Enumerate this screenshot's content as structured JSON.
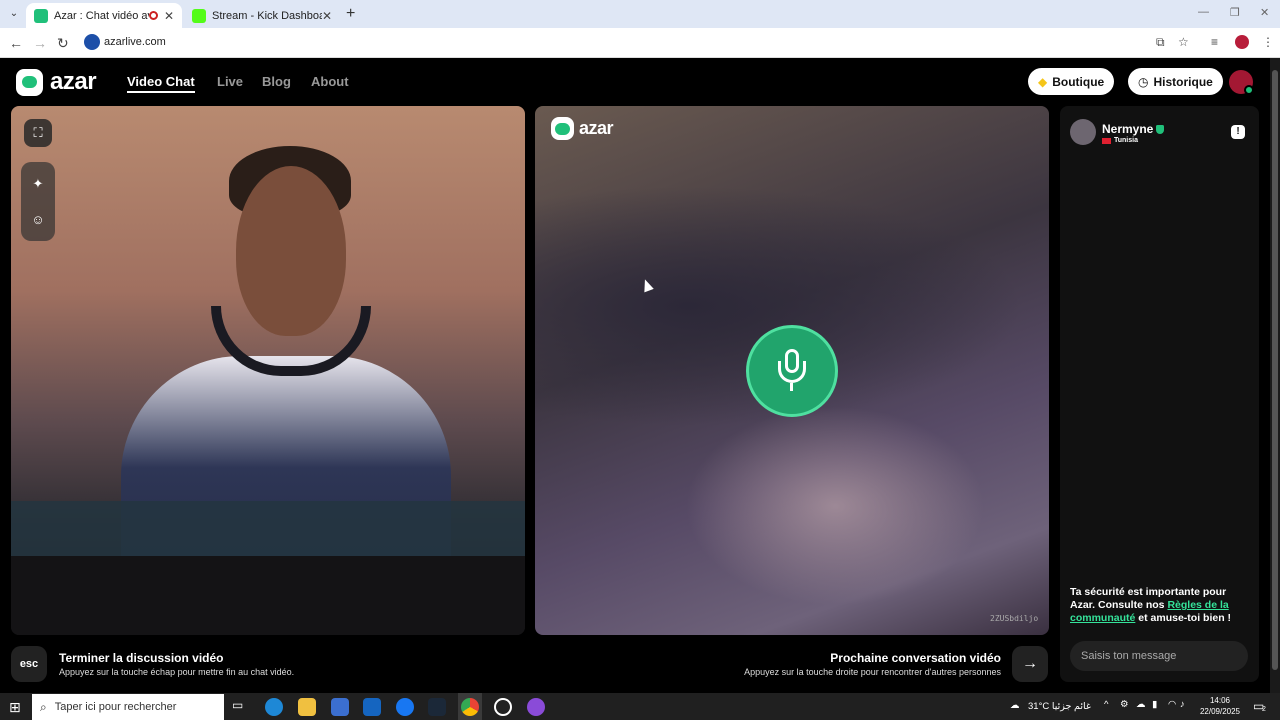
{
  "browser": {
    "tabs": [
      {
        "title": "Azar : Chat vidéo avec de n",
        "active": true
      },
      {
        "title": "Stream - Kick Dashboard",
        "active": false
      }
    ],
    "url": "azarlive.com"
  },
  "header": {
    "logo": "azar",
    "nav": [
      "Video Chat",
      "Live",
      "Blog",
      "About"
    ],
    "boutique": "Boutique",
    "historique": "Historique"
  },
  "remote": {
    "logo": "azar",
    "video_id": "2ZUSbdiljo"
  },
  "chat": {
    "name": "Nermyne",
    "country": "Tunisia",
    "safety_prefix": "Ta sécurité est importante pour Azar. Consulte nos ",
    "safety_link": "Règles de la communauté",
    "safety_suffix": " et amuse-toi bien !",
    "input_placeholder": "Saisis ton message"
  },
  "actions": {
    "esc_label": "esc",
    "end_title": "Terminer la discussion vidéo",
    "end_sub": "Appuyez sur la touche échap pour mettre fin au chat vidéo.",
    "next_title": "Prochaine conversation vidéo",
    "next_sub": "Appuyez sur la touche droite pour rencontrer d'autres personnes",
    "next_arrow": "→"
  },
  "taskbar": {
    "search_placeholder": "Taper ici pour rechercher",
    "weather": "31°C  غائم جزئيا",
    "time": "14:06",
    "date": "22/09/2025",
    "notifications": "2"
  },
  "colors": {
    "accent": "#20c07a",
    "mic_bg": "#21a46c",
    "link": "#35e39a"
  }
}
